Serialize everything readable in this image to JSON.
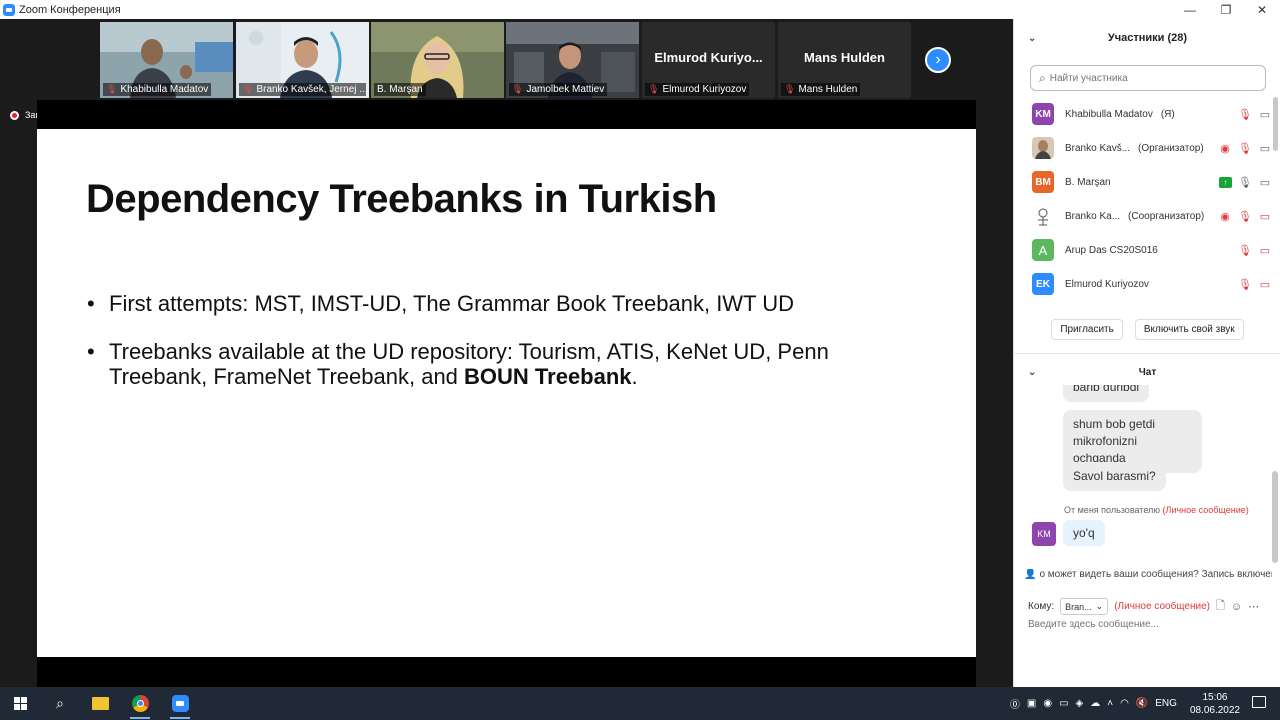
{
  "window": {
    "title": "Zoom Конференция"
  },
  "strip": {
    "tiles": [
      {
        "name": "Khabibulla Madatov"
      },
      {
        "name": "Branko Kavšek, Jernej ..."
      },
      {
        "name": "B. Marşan"
      },
      {
        "name": "Jamolbek Mattiev"
      },
      {
        "name": "Elmurod Kuriyozov",
        "big": "Elmurod Kuriyo..."
      },
      {
        "name": "Mans Hulden",
        "big": "Mans Hulden"
      }
    ]
  },
  "recording": {
    "label": "Запись"
  },
  "slide": {
    "title": "Dependency Treebanks in Turkish",
    "bullets": {
      "first": "First attempts: MST, IMST-UD, The Grammar Book Treebank, IWT UD",
      "second_plain": "Treebanks available at the UD repository: Tourism, ATIS, KeNet UD, Penn Treebank, FrameNet Treebank, and ",
      "second_bold": "BOUN Treebank",
      "second_end": "."
    }
  },
  "participants": {
    "header": "Участники (28)",
    "search_placeholder": "Найти участника",
    "list": [
      {
        "initials": "KM",
        "color": "#8e44ad",
        "name": "Khabibulla Madatov",
        "role": "(Я)"
      },
      {
        "initials": "",
        "color": "#9a7b5a",
        "name": "Branko Kavš...",
        "role": "(Организатор)"
      },
      {
        "initials": "BM",
        "color": "#e8662a",
        "name": "B. Marşan",
        "role": ""
      },
      {
        "initials": "",
        "color": "#ffffff",
        "name": "Branko Ka...",
        "role": "(Соорганизатор)"
      },
      {
        "initials": "A",
        "color": "#5cb85c",
        "name": "Arup Das CS20S016",
        "role": ""
      },
      {
        "initials": "EK",
        "color": "#2d8cff",
        "name": "Elmurod Kuriyozov",
        "role": ""
      }
    ],
    "invite_button": "Пригласить",
    "unmute_button": "Включить свой звук"
  },
  "chat": {
    "header": "Чат",
    "messages": [
      "barib duribdi",
      "shum bob getdi mikrofonizni ochganda",
      "Savol barasmi?"
    ],
    "my_meta": "От меня пользователю",
    "my_meta_private": "(Личное сообщение)",
    "my_initials": "KM",
    "my_message": "yo'q",
    "notice": "о может видеть ваши сообщения? Запись включена",
    "to_label": "Кому:",
    "recipient": "Bran...",
    "private_label": "(Личное сообщение)",
    "input_placeholder": "Введите здесь сообщение..."
  },
  "taskbar": {
    "lang": "ENG",
    "time": "15:06",
    "date": "08.06.2022"
  }
}
